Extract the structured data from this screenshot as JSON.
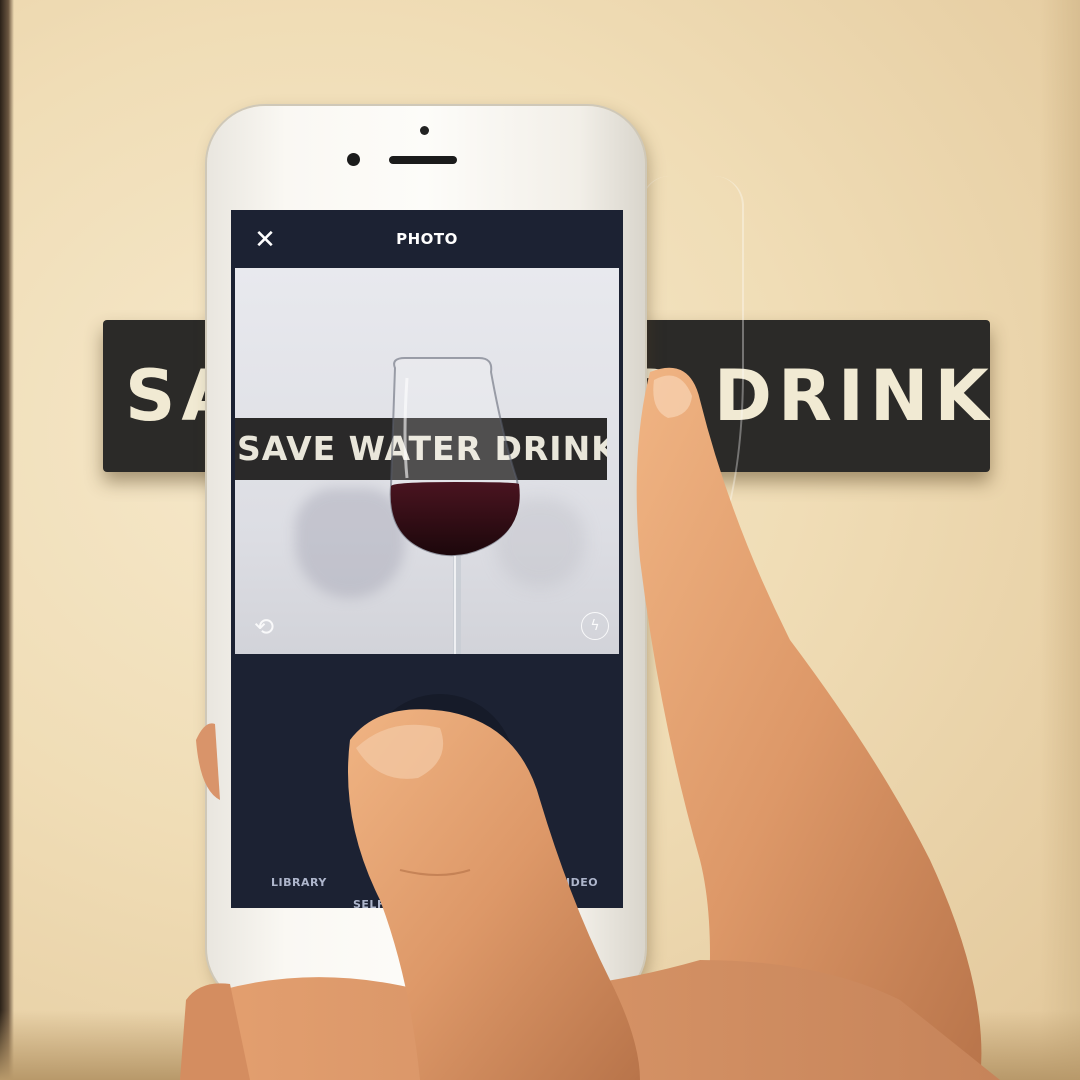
{
  "wall_sign": {
    "text": "SAVE WATER DRINK WINE"
  },
  "camera_app": {
    "title": "PHOTO",
    "close_icon": "close-icon",
    "viewfinder_sign_text": "SAVE WATER DRINK WINE",
    "switch_camera_icon": "switch-camera-icon",
    "flash_icon": "flash-icon",
    "modes": [
      "LIBRARY",
      "SELFIE",
      "VIDEO"
    ]
  },
  "colors": {
    "app_background": "#1c2233",
    "sign_background": "#2b2a28",
    "wall": "#f0ddb6",
    "wine": "#3a0f17"
  }
}
